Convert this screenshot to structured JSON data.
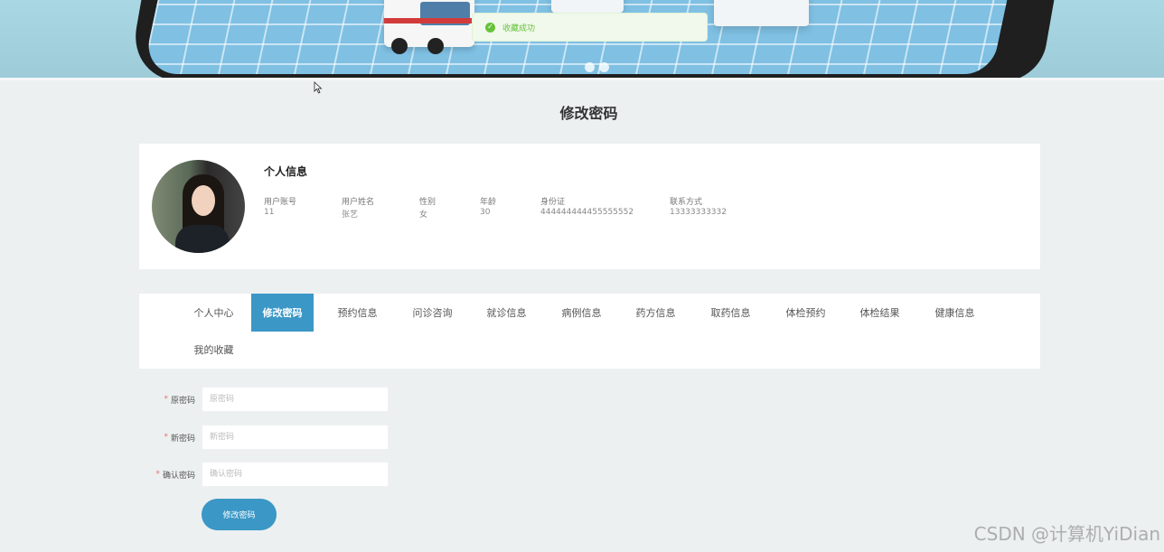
{
  "toast": {
    "message": "收藏成功"
  },
  "page_title": "修改密码",
  "profile": {
    "section_title": "个人信息",
    "fields": [
      {
        "label": "用户账号",
        "value": "11"
      },
      {
        "label": "用户姓名",
        "value": "张艺"
      },
      {
        "label": "性别",
        "value": "女"
      },
      {
        "label": "年龄",
        "value": "30"
      },
      {
        "label": "身份证",
        "value": "444444444455555552"
      },
      {
        "label": "联系方式",
        "value": "13333333332"
      }
    ]
  },
  "tabs": [
    {
      "label": "个人中心",
      "active": false
    },
    {
      "label": "修改密码",
      "active": true
    },
    {
      "label": "预约信息",
      "active": false
    },
    {
      "label": "问诊咨询",
      "active": false
    },
    {
      "label": "就诊信息",
      "active": false
    },
    {
      "label": "病例信息",
      "active": false
    },
    {
      "label": "药方信息",
      "active": false
    },
    {
      "label": "取药信息",
      "active": false
    },
    {
      "label": "体检预约",
      "active": false
    },
    {
      "label": "体检结果",
      "active": false
    },
    {
      "label": "健康信息",
      "active": false
    },
    {
      "label": "我的收藏",
      "active": false
    }
  ],
  "form": {
    "required_mark": "*",
    "old_password": {
      "label": "原密码",
      "placeholder": "原密码"
    },
    "new_password": {
      "label": "新密码",
      "placeholder": "新密码"
    },
    "confirm_password": {
      "label": "确认密码",
      "placeholder": "确认密码"
    },
    "submit_label": "修改密码"
  },
  "watermark": "CSDN @计算机YiDian",
  "colors": {
    "accent": "#3b97c6",
    "success": "#67c23a",
    "required": "#f56c6c",
    "background": "#ecf0f1"
  },
  "icons": {
    "toast": "check-circle-icon",
    "cursor": "mouse-pointer-icon"
  }
}
